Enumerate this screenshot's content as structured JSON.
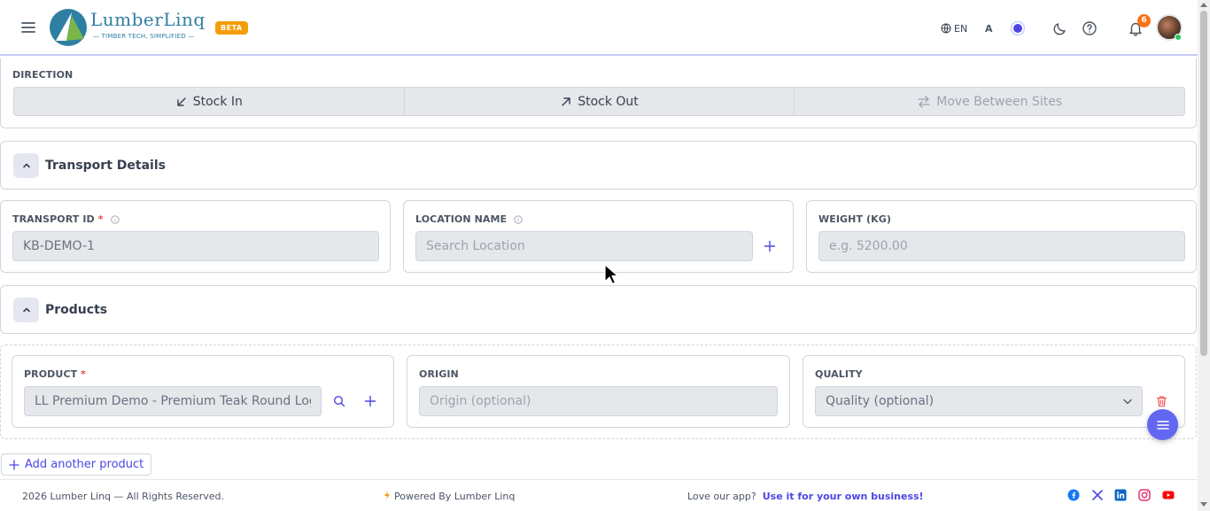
{
  "header": {
    "logo_text": "LumberLinq",
    "logo_tagline": "TIMBER TECH, SIMPLIFIED",
    "beta_badge": "BETA",
    "language": "EN",
    "font_toggle": "A",
    "notification_count": "6"
  },
  "direction": {
    "label": "DIRECTION",
    "options": [
      {
        "label": "Stock In",
        "icon": "arrow-down-left-icon"
      },
      {
        "label": "Stock Out",
        "icon": "arrow-up-right-icon"
      },
      {
        "label": "Move Between Sites",
        "icon": "arrows-swap-icon"
      }
    ]
  },
  "transport_section": {
    "title": "Transport Details"
  },
  "transport_fields": {
    "transport_id": {
      "label": "TRANSPORT ID",
      "required": "*",
      "value": "KB-DEMO-1"
    },
    "location_name": {
      "label": "LOCATION NAME",
      "placeholder": "Search Location"
    },
    "weight": {
      "label": "WEIGHT (KG)",
      "placeholder": "e.g. 5200.00"
    }
  },
  "products_section": {
    "title": "Products"
  },
  "product_row": {
    "product": {
      "label": "PRODUCT",
      "required": "*",
      "value": "LL Premium Demo - Premium Teak Round Logs"
    },
    "origin": {
      "label": "ORIGIN",
      "placeholder": "Origin (optional)"
    },
    "quality": {
      "label": "QUALITY",
      "selected": "Quality (optional)"
    }
  },
  "add_product_label": "Add another product",
  "footer": {
    "copyright": "2026 Lumber Linq — All Rights Reserved.",
    "powered_by": "Powered By Lumber Linq",
    "promo_text": "Love our app?",
    "promo_link": "Use it for your own business!"
  },
  "colors": {
    "accent": "#4f46e5",
    "logo_blue": "#2f7fa3",
    "beta": "#f59e0b",
    "notification": "#f97316",
    "delete": "#ef4444"
  }
}
